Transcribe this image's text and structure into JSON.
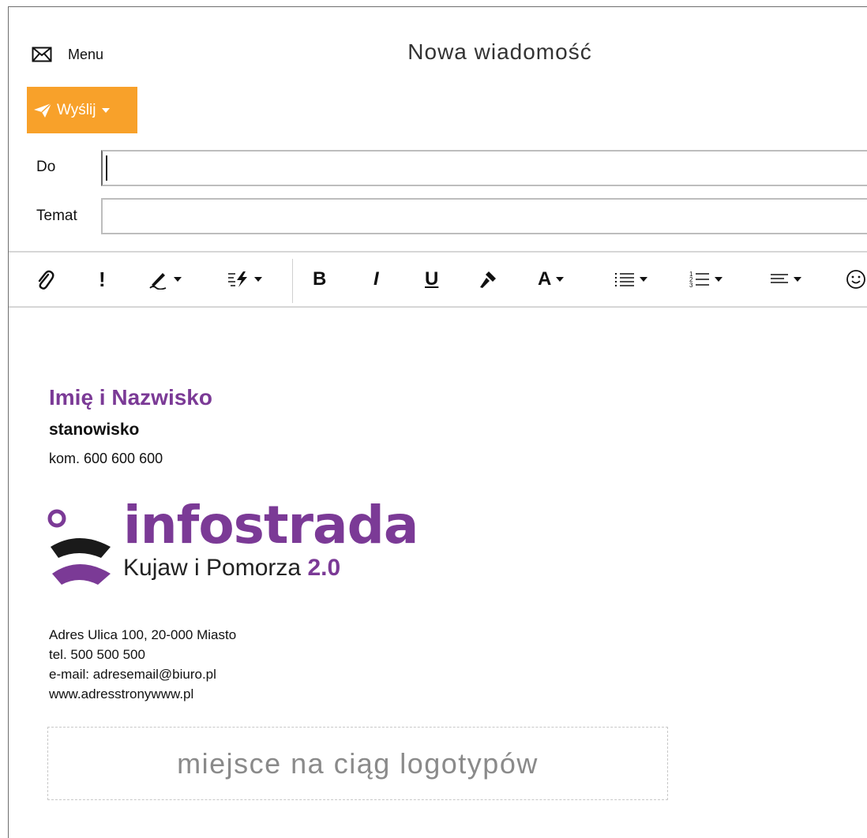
{
  "header": {
    "menu_label": "Menu",
    "title": "Nowa wiadomość"
  },
  "actions": {
    "send_label": "Wyślij"
  },
  "fields": {
    "to_label": "Do",
    "to_value": "",
    "subject_label": "Temat",
    "subject_value": ""
  },
  "toolbar": {
    "icons": [
      "paperclip-icon",
      "exclamation-icon",
      "signature-icon",
      "quick-parts-icon",
      "bold-icon",
      "italic-icon",
      "underline-icon",
      "format-painter-icon",
      "font-color-icon",
      "bulleted-list-icon",
      "numbered-list-icon",
      "align-icon",
      "emoji-icon"
    ],
    "bold": "B",
    "italic": "I",
    "underline": "U",
    "font_color": "A",
    "important": "!"
  },
  "signature": {
    "name": "Imię i Nazwisko",
    "position": "stanowisko",
    "mobile": "kom. 600 600 600",
    "logo_main": "infostrada",
    "logo_sub": "Kujaw i Pomorza",
    "logo_version": "2.0",
    "address": "Adres Ulica 100, 20-000 Miasto",
    "phone": "tel. 500 500 500",
    "email": "e-mail: adresemail@biuro.pl",
    "website": "www.adresstronywww.pl",
    "logos_placeholder": "miejsce na ciąg logotypów"
  },
  "colors": {
    "accent": "#f8a12a",
    "brand": "#7b3a96"
  }
}
